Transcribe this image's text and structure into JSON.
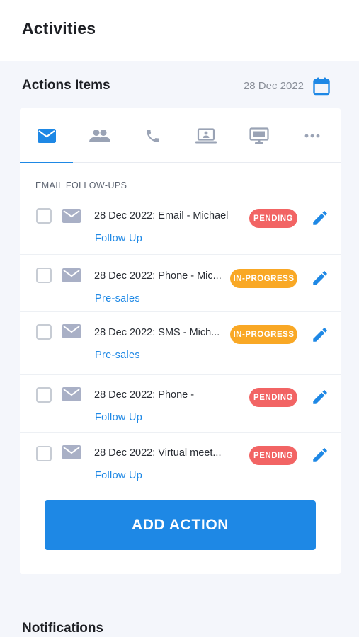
{
  "header": {
    "title": "Activities"
  },
  "actions": {
    "title": "Actions Items",
    "date": "28 Dec 2022",
    "calendar_icon": "calendar-icon"
  },
  "tabs": [
    {
      "name": "email",
      "icon": "mail-icon",
      "active": true
    },
    {
      "name": "meetings",
      "icon": "people-icon",
      "active": false
    },
    {
      "name": "calls",
      "icon": "phone-icon",
      "active": false
    },
    {
      "name": "virtual",
      "icon": "laptop-icon",
      "active": false
    },
    {
      "name": "demo",
      "icon": "monitor-icon",
      "active": false
    },
    {
      "name": "more",
      "icon": "more-icon",
      "active": false
    }
  ],
  "group_label": "EMAIL FOLLOW-UPS",
  "items": [
    {
      "title": "28 Dec 2022: Email - Michael",
      "subtitle": "Follow Up",
      "status": "PENDING"
    },
    {
      "title": "28 Dec 2022: Phone - Mic...",
      "subtitle": "Pre-sales",
      "status": "IN-PROGRESS"
    },
    {
      "title": "28 Dec 2022: SMS - Mich...",
      "subtitle": "Pre-sales",
      "status": "IN-PROGRESS"
    },
    {
      "title": "28 Dec 2022: Phone -",
      "subtitle": "Follow Up",
      "status": "PENDING"
    },
    {
      "title": "28 Dec 2022: Virtual meet...",
      "subtitle": "Follow Up",
      "status": "PENDING"
    }
  ],
  "add_button": "ADD ACTION",
  "notifications": {
    "title": "Notifications"
  },
  "colors": {
    "accent": "#1e88e5",
    "pending": "#f26464",
    "in_progress": "#f9a825",
    "icon_inactive": "#9aa3b5"
  }
}
